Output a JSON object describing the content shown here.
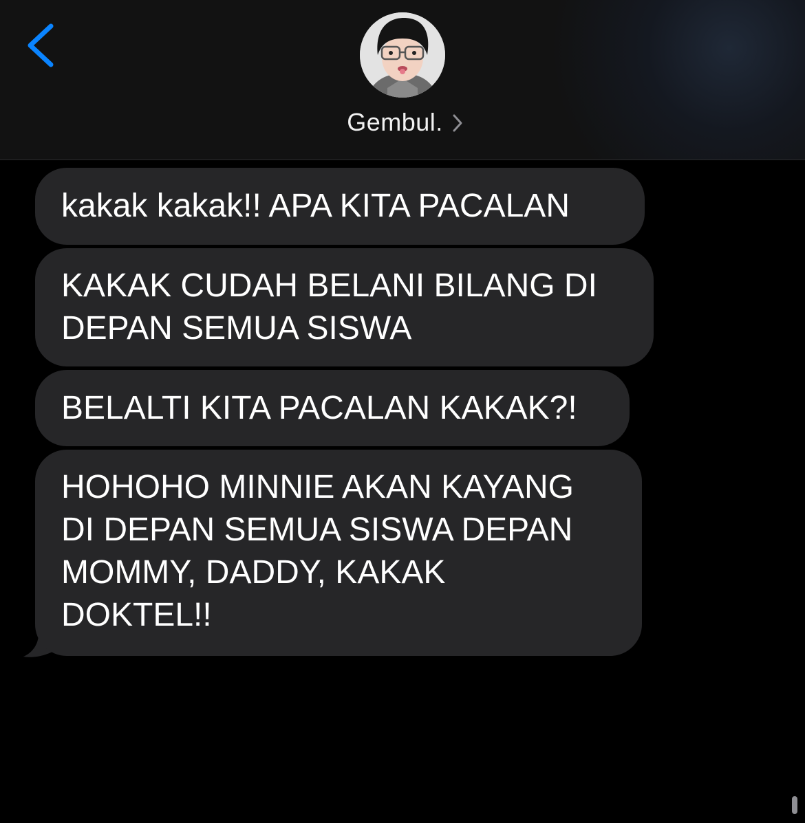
{
  "header": {
    "back_icon": "chevron-left-icon",
    "avatar_icon": "contact-avatar-photo",
    "contact_name": "Gembul.",
    "detail_icon": "chevron-right-icon"
  },
  "messages": [
    {
      "lines": [
        "kakak kakak!! APA KITA PACALAN"
      ]
    },
    {
      "lines": [
        "KAKAK CUDAH BELANI BILANG DI",
        "DEPAN SEMUA SISWA"
      ]
    },
    {
      "lines": [
        "BELALTI KITA PACALAN KAKAK?!"
      ]
    },
    {
      "lines": [
        "HOHOHO MINNIE AKAN KAYANG",
        "DI DEPAN SEMUA SISWA DEPAN",
        "MOMMY, DADDY, KAKAK",
        "DOKTEL!!"
      ]
    }
  ],
  "colors": {
    "accent": "#0a84ff",
    "incoming_bubble": "#262628",
    "background": "#000000",
    "header_background": "#121212",
    "text": "#ffffff"
  }
}
